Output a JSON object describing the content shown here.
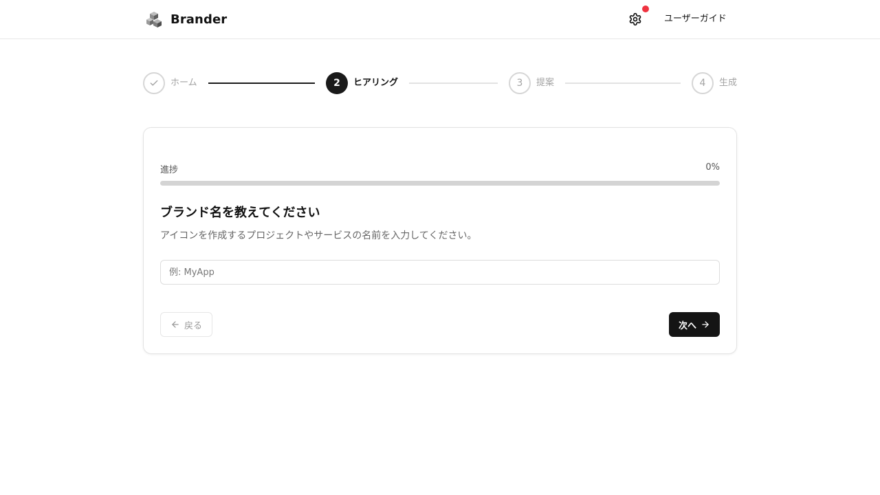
{
  "header": {
    "brand_name": "Brander",
    "guide_label": "ユーザーガイド",
    "notification_color": "#ef3340"
  },
  "stepper": {
    "steps": [
      {
        "number": "1",
        "label": "ホーム",
        "state": "done"
      },
      {
        "number": "2",
        "label": "ヒアリング",
        "state": "active"
      },
      {
        "number": "3",
        "label": "提案",
        "state": "upcoming"
      },
      {
        "number": "4",
        "label": "生成",
        "state": "upcoming"
      }
    ]
  },
  "card": {
    "progress_label": "進捗",
    "progress_text": "0%",
    "progress_fraction": 0,
    "question_title": "ブランド名を教えてください",
    "question_description": "アイコンを作成するプロジェクトやサービスの名前を入力してください。",
    "input_value": "",
    "input_placeholder": "例: MyApp",
    "back_label": "戻る",
    "next_label": "次へ"
  },
  "icons": {
    "logo": "cube-stack-logo",
    "settings": "gear-icon",
    "step_done": "check-icon",
    "back": "arrow-left-icon",
    "next": "arrow-right-icon"
  }
}
